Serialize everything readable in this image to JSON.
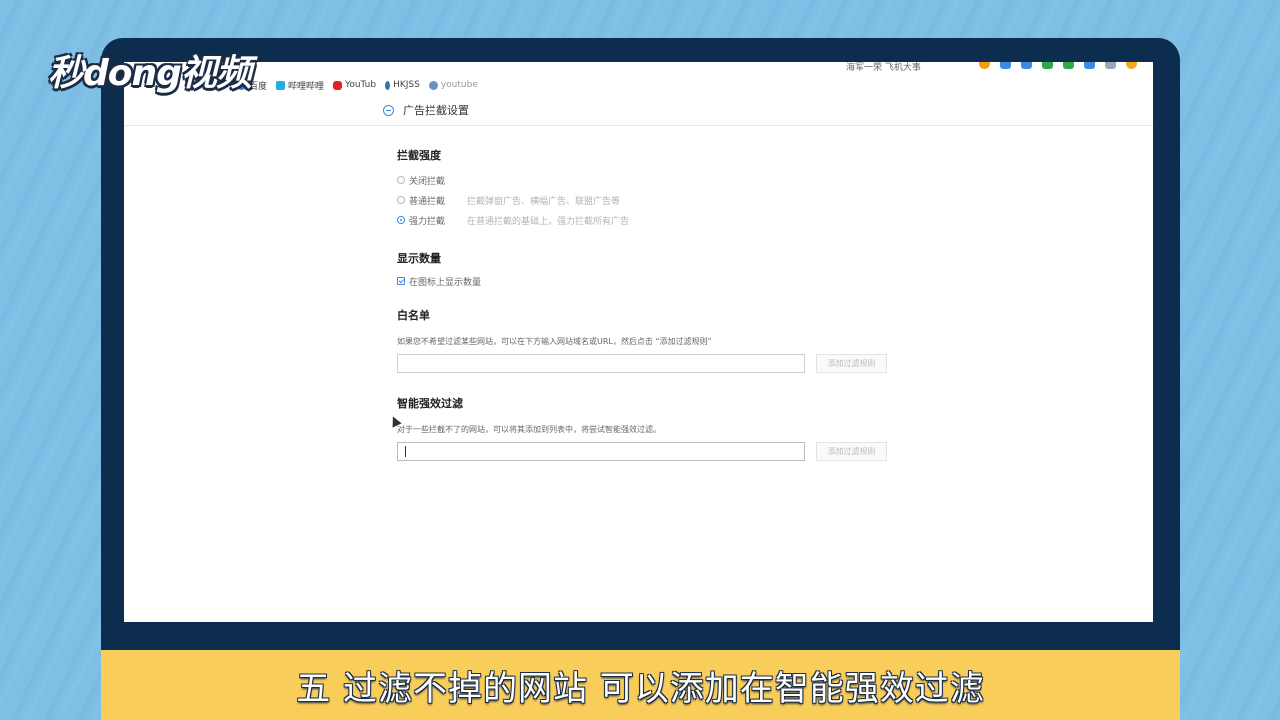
{
  "logo": {
    "text": "秒dong视频"
  },
  "browser": {
    "address_fragment": "海军一荣 飞机大事",
    "bookmarks": [
      {
        "label": "百度",
        "color": "#2f7ee8"
      },
      {
        "label": "哔哩哔哩",
        "color": "#23ade5"
      },
      {
        "label": "YouTub",
        "color": "#e62117"
      },
      {
        "label": "HKJSS",
        "color": "#3a6fb0"
      },
      {
        "label": "youtube",
        "color": "#6b8fc9"
      }
    ],
    "toolbar_icon_colors": [
      "#f39c12",
      "#3b8be0",
      "#3b8be0",
      "#2eaa4a",
      "#2eaa4a",
      "#3b8be0",
      "#9aa7b8",
      "#f5a623"
    ]
  },
  "settings": {
    "title": "广告拦截设置",
    "block_level": {
      "title": "拦截强度",
      "options": [
        {
          "label": "关闭拦截",
          "desc": "",
          "checked": false
        },
        {
          "label": "普通拦截",
          "desc": "拦截弹窗广告、横幅广告、联盟广告等",
          "checked": false
        },
        {
          "label": "强力拦截",
          "desc": "在普通拦截的基础上，强力拦截所有广告",
          "checked": true
        }
      ]
    },
    "show_count": {
      "title": "显示数量",
      "checkbox_label": "在图标上显示数量",
      "checked": true
    },
    "whitelist": {
      "title": "白名单",
      "desc": "如果您不希望过滤某些网站，可以在下方输入网站域名或URL，然后点击 “添加过滤规则”",
      "input_value": "",
      "button_label": "添加过滤规则"
    },
    "smart_filter": {
      "title": "智能强效过滤",
      "desc": "对于一些拦截不了的网站，可以将其添加到列表中，将尝试智能强效过滤。",
      "input_value": "",
      "button_label": "添加过滤规则"
    }
  },
  "caption": {
    "text": "五 过滤不掉的网站 可以添加在智能强效过滤"
  }
}
